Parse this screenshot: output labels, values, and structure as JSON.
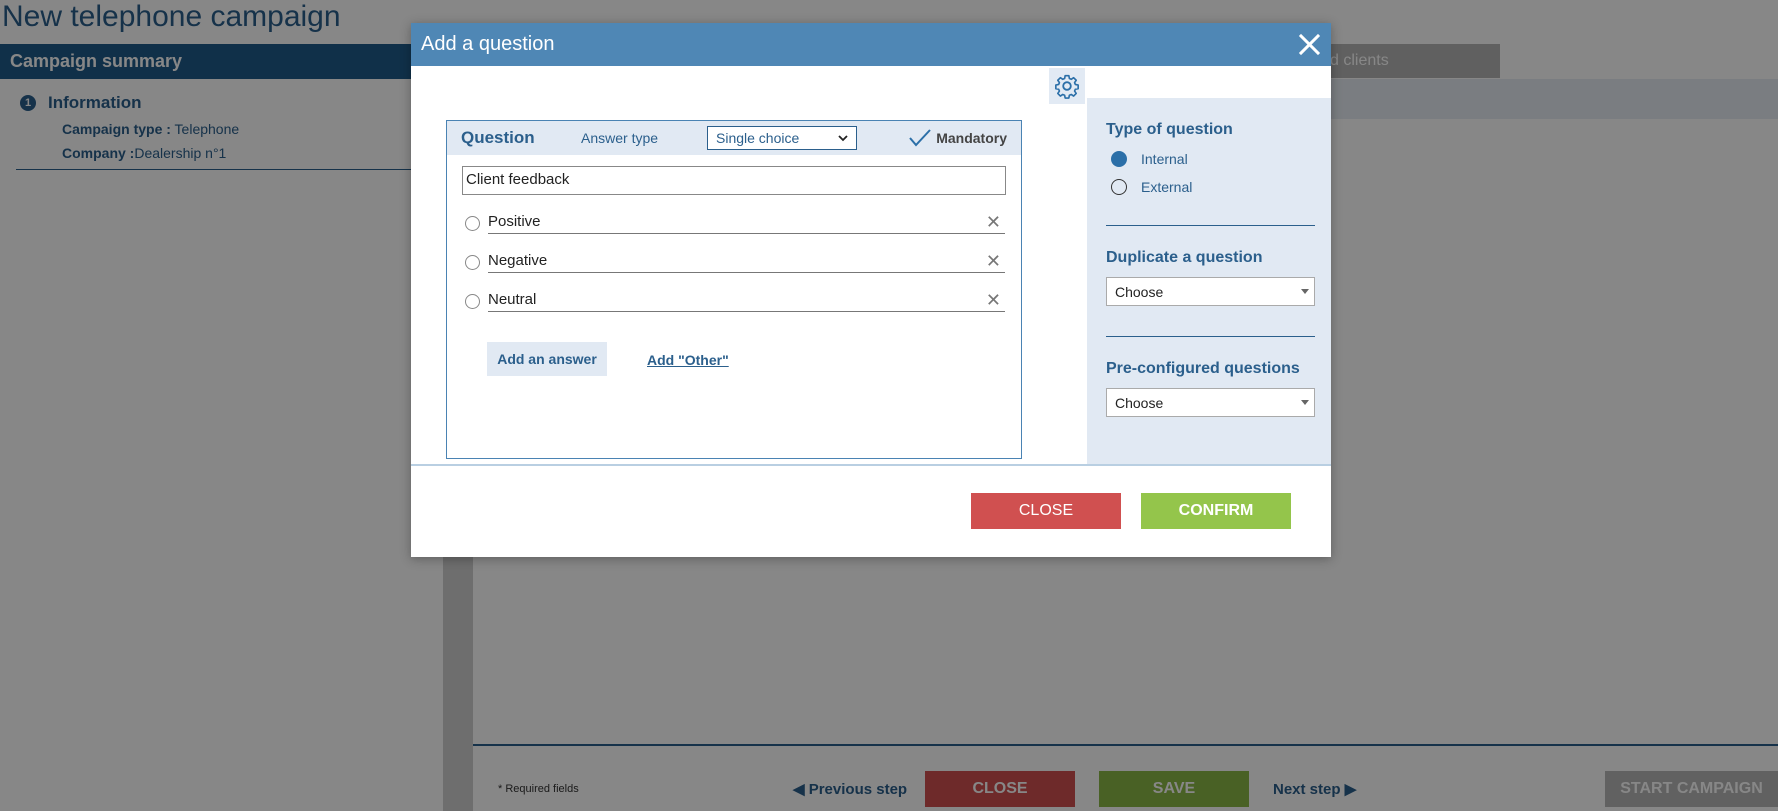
{
  "page": {
    "title": "New telephone campaign",
    "summary_header": "Campaign summary",
    "info": {
      "step_number": "1",
      "title": "Information",
      "campaign_type_label": "Campaign type :",
      "campaign_type_value": "Telephone",
      "company_label": "Company :",
      "company_value": "Dealership n°1"
    },
    "tab_partial": "d clients",
    "required_note": "* Required fields",
    "previous_step": "Previous step",
    "next_step": "Next step",
    "close_label": "CLOSE",
    "save_label": "SAVE",
    "start_label": "START CAMPAIGN"
  },
  "modal": {
    "title": "Add a question",
    "question_label": "Question",
    "answer_type_label": "Answer type",
    "answer_type_value": "Single choice",
    "mandatory_label": "Mandatory",
    "question_text": "Client feedback",
    "answers": [
      "Positive",
      "Negative",
      "Neutral"
    ],
    "add_answer_label": "Add an answer",
    "add_other_label": "Add \"Other\"",
    "side": {
      "type_title": "Type of question",
      "type_options": [
        "Internal",
        "External"
      ],
      "selected_type": "Internal",
      "duplicate_title": "Duplicate a question",
      "duplicate_value": "Choose",
      "preconfigured_title": "Pre-configured questions",
      "preconfigured_value": "Choose"
    },
    "close_label": "CLOSE",
    "confirm_label": "CONFIRM"
  },
  "colors": {
    "brand_blue": "#2b5f8c",
    "header_blue": "#4f87b5",
    "close_red": "#d05050",
    "confirm_green": "#94c54b"
  },
  "icons": {
    "close": "close-icon",
    "settings": "gear-icon",
    "check": "check-icon",
    "remove": "remove-answer-icon"
  }
}
